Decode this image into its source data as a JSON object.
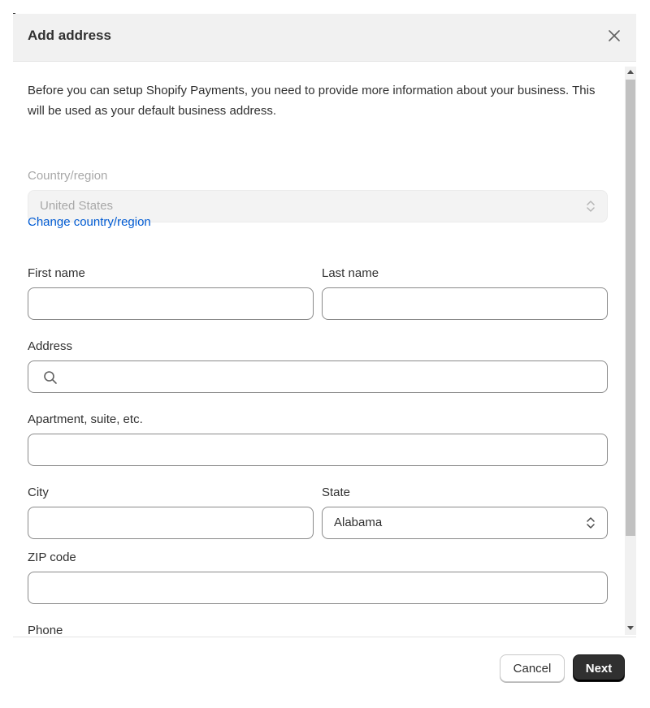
{
  "dialog": {
    "title": "Add address",
    "intro": "Before you can setup Shopify Payments, you need to provide more information about your business. This will be used as your default business address."
  },
  "form": {
    "country_label": "Country/region",
    "country_value": "United States",
    "change_country_link": "Change country/region",
    "first_name_label": "First name",
    "first_name_value": "",
    "last_name_label": "Last name",
    "last_name_value": "",
    "address_label": "Address",
    "address_value": "",
    "apartment_label": "Apartment, suite, etc.",
    "apartment_value": "",
    "city_label": "City",
    "city_value": "",
    "state_label": "State",
    "state_value": "Alabama",
    "zip_label": "ZIP code",
    "zip_value": "",
    "phone_label": "Phone",
    "phone_value": ""
  },
  "footer": {
    "cancel_label": "Cancel",
    "next_label": "Next"
  },
  "icons": {
    "close": "close-icon",
    "search": "search-icon",
    "select": "chevron-up-down-icon"
  },
  "colors": {
    "link": "#005bd3",
    "primary_button": "#303030",
    "header_bg": "#f1f1f1"
  }
}
